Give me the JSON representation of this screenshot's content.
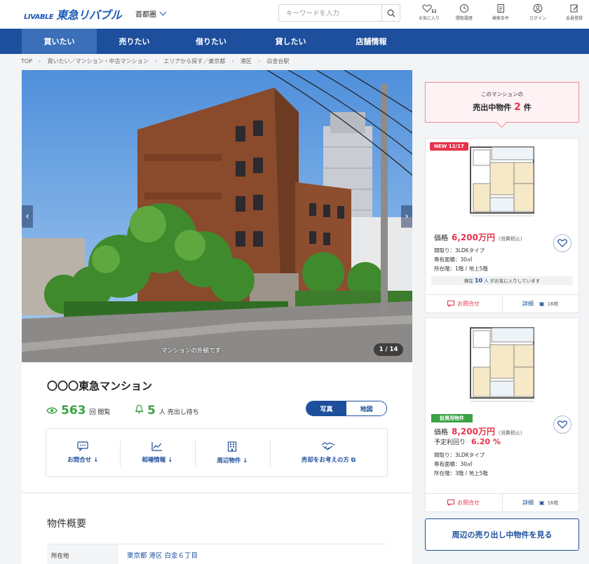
{
  "header": {
    "logo_mark": "LIVABLE",
    "logo_text": "東急リバブル",
    "region": "首都圏",
    "search_placeholder": "キーワードを入力",
    "nav": [
      {
        "label": "お気に入り",
        "badge": "12"
      },
      {
        "label": "閲覧履歴"
      },
      {
        "label": "検索条件"
      },
      {
        "label": "ログイン"
      },
      {
        "label": "会員登録"
      }
    ]
  },
  "main_nav": [
    "買いたい",
    "売りたい",
    "借りたい",
    "貸したい",
    "店舗情報"
  ],
  "breadcrumb": [
    "TOP",
    "買いたい／マンション・中古マンション",
    "エリアから探す／東京都",
    "港区",
    "白金台駅"
  ],
  "gallery": {
    "caption": "マンションの外観です",
    "counter": "1 / 14"
  },
  "property": {
    "name": "〇〇〇東急マンション",
    "views": "563",
    "views_unit": "回 閲覧",
    "waiting": "5",
    "waiting_unit": "人 売出し待ち",
    "toggle": [
      "写真",
      "地図"
    ],
    "actions": [
      {
        "label": "お問合せ ↓",
        "icon": "chat-icon"
      },
      {
        "label": "相場情報 ↓",
        "icon": "chart-icon"
      },
      {
        "label": "周辺物件 ↓",
        "icon": "building-icon"
      },
      {
        "label": "売却をお考えの方 ⧉",
        "icon": "handshake-icon"
      }
    ]
  },
  "overview": {
    "title": "物件概要",
    "rows": [
      {
        "key": "所在地",
        "value": "東京都 港区 白金６丁目"
      }
    ]
  },
  "sidebar": {
    "count_line1": "このマンションの",
    "count_prefix": "売出中物件",
    "count_num": "2",
    "count_suffix": "件",
    "listings": [
      {
        "badge": "NEW 12/17",
        "price_label": "価格",
        "price": "6,200万円",
        "tax": "(消費税込)",
        "layout": "間取り：3LDKタイプ",
        "area": "専有面積：30㎡",
        "floor": "所在階：1階 / 地上5階",
        "fav_prefix": "現在",
        "fav_count": "10",
        "fav_suffix": "人 がお気に入りしています",
        "inquiry": "お問合せ",
        "detail": "詳細",
        "photos": "16枚"
      },
      {
        "badge": "投資用物件",
        "price_label": "価格",
        "price": "8,200万円",
        "tax": "(消費税込)",
        "yield_label": "予定利回り",
        "yield": "6.20 %",
        "layout": "間取り：3LDKタイプ",
        "area": "専有面積：30㎡",
        "floor": "所在階：3階 / 地上5階",
        "inquiry": "お問合せ",
        "detail": "詳細",
        "photos": "16枚"
      }
    ],
    "nearby_button": "周辺の売り出し中物件を見る"
  },
  "colors": {
    "brand_blue": "#1d4f9c",
    "accent_red": "#e6334b",
    "accent_green": "#3aa346"
  }
}
